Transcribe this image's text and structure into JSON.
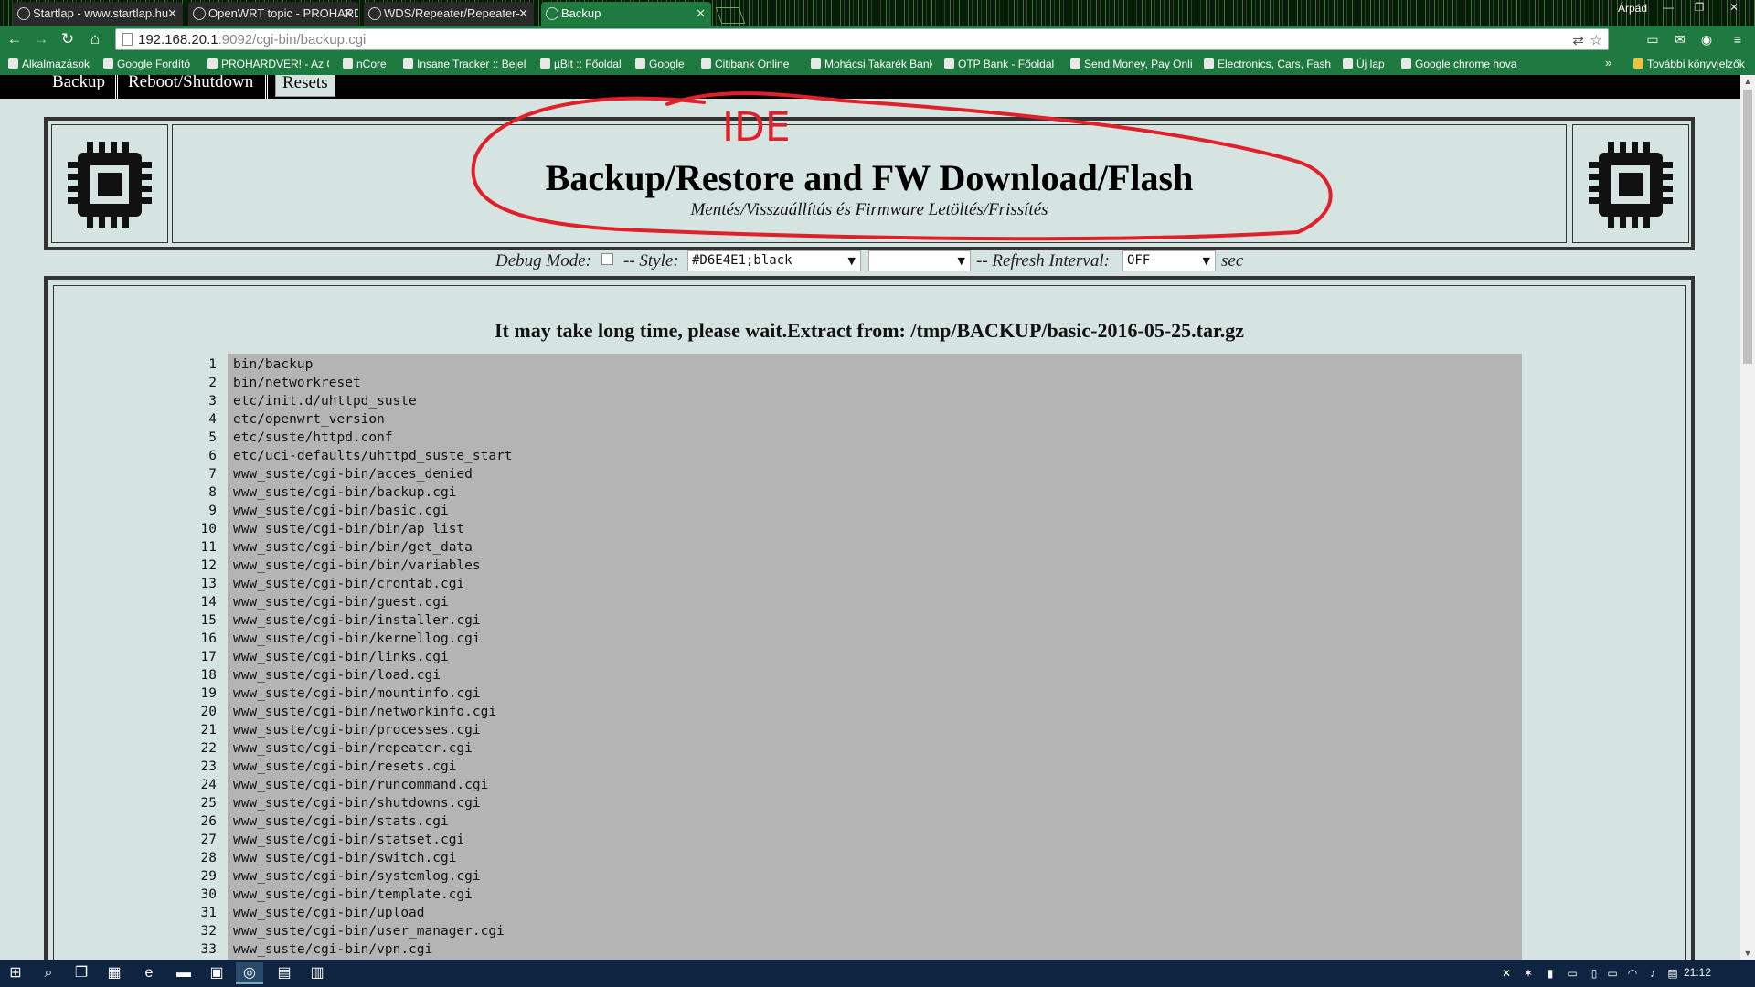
{
  "browser": {
    "tabs": [
      {
        "title": "Startlap - www.startlap.hu",
        "active": false
      },
      {
        "title": "OpenWRT topic - PROHARDVER!",
        "active": false
      },
      {
        "title": "WDS/Repeater/Repeater-",
        "active": false
      },
      {
        "title": "Backup",
        "active": true
      }
    ],
    "user": "Árpád",
    "url_host": "192.168.20.1",
    "url_path": ":9092/cgi-bin/backup.cgi",
    "bookmarks": [
      "Alkalmazások",
      "Google Fordító",
      "PROHARDVER! - Az O",
      "nCore",
      "Insane Tracker :: Bejele",
      "µBit :: Főoldal",
      "Google",
      "Citibank Online",
      "Mohácsi Takarék Bank",
      "OTP Bank - Főoldal",
      "Send Money, Pay Onli",
      "Electronics, Cars, Fash",
      "Új lap",
      "Google chrome hova"
    ],
    "more_bookmarks": "»",
    "other_bookmarks": "További könyvjelzők"
  },
  "topnav": {
    "items": [
      "Backup",
      "Reboot/Shutdown",
      "Resets"
    ],
    "active": "Resets"
  },
  "header": {
    "title": "Backup/Restore and FW Download/Flash",
    "subtitle": "Mentés/Visszaállítás és Firmware Letöltés/Frissítés",
    "annotation": "IDE",
    "annotation_color": "#e0202a"
  },
  "controls": {
    "debug_label": "Debug Mode:",
    "style_label": "-- Style:",
    "style_value": "#D6E4E1;black",
    "second_select_value": "",
    "refresh_label": "-- Refresh Interval:",
    "refresh_value": "OFF",
    "refresh_unit": "sec"
  },
  "main": {
    "status": "It may take long time, please wait.Extract from: /tmp/BACKUP/basic-2016-05-25.tar.gz",
    "listing": [
      {
        "n": "1",
        "text": "bin/backup"
      },
      {
        "n": "2",
        "text": "bin/networkreset"
      },
      {
        "n": "3",
        "text": "etc/init.d/uhttpd_suste"
      },
      {
        "n": "4",
        "text": "etc/openwrt_version"
      },
      {
        "n": "5",
        "text": "etc/suste/httpd.conf"
      },
      {
        "n": "6",
        "text": "etc/uci-defaults/uhttpd_suste_start"
      },
      {
        "n": "7",
        "text": "www_suste/cgi-bin/acces_denied"
      },
      {
        "n": "8",
        "text": "www_suste/cgi-bin/backup.cgi"
      },
      {
        "n": "9",
        "text": "www_suste/cgi-bin/basic.cgi"
      },
      {
        "n": "10",
        "text": "www_suste/cgi-bin/bin/ap_list"
      },
      {
        "n": "11",
        "text": "www_suste/cgi-bin/bin/get_data"
      },
      {
        "n": "12",
        "text": "www_suste/cgi-bin/bin/variables"
      },
      {
        "n": "13",
        "text": "www_suste/cgi-bin/crontab.cgi"
      },
      {
        "n": "14",
        "text": "www_suste/cgi-bin/guest.cgi"
      },
      {
        "n": "15",
        "text": "www_suste/cgi-bin/installer.cgi"
      },
      {
        "n": "16",
        "text": "www_suste/cgi-bin/kernellog.cgi"
      },
      {
        "n": "17",
        "text": "www_suste/cgi-bin/links.cgi"
      },
      {
        "n": "18",
        "text": "www_suste/cgi-bin/load.cgi"
      },
      {
        "n": "19",
        "text": "www_suste/cgi-bin/mountinfo.cgi"
      },
      {
        "n": "20",
        "text": "www_suste/cgi-bin/networkinfo.cgi"
      },
      {
        "n": "21",
        "text": "www_suste/cgi-bin/processes.cgi"
      },
      {
        "n": "22",
        "text": "www_suste/cgi-bin/repeater.cgi"
      },
      {
        "n": "23",
        "text": "www_suste/cgi-bin/resets.cgi"
      },
      {
        "n": "24",
        "text": "www_suste/cgi-bin/runcommand.cgi"
      },
      {
        "n": "25",
        "text": "www_suste/cgi-bin/shutdowns.cgi"
      },
      {
        "n": "26",
        "text": "www_suste/cgi-bin/stats.cgi"
      },
      {
        "n": "27",
        "text": "www_suste/cgi-bin/statset.cgi"
      },
      {
        "n": "28",
        "text": "www_suste/cgi-bin/switch.cgi"
      },
      {
        "n": "29",
        "text": "www_suste/cgi-bin/systemlog.cgi"
      },
      {
        "n": "30",
        "text": "www_suste/cgi-bin/template.cgi"
      },
      {
        "n": "31",
        "text": "www_suste/cgi-bin/upload"
      },
      {
        "n": "32",
        "text": "www_suste/cgi-bin/user_manager.cgi"
      },
      {
        "n": "33",
        "text": "www_suste/cgi-bin/vpn.cgi"
      }
    ]
  },
  "taskbar": {
    "clock": "21:12"
  },
  "colors": {
    "page_bg": "#d6e4e1",
    "browser_green": "#1f7a3f",
    "listing_bg": "#b4b4b4",
    "taskbar": "#0e2440"
  }
}
